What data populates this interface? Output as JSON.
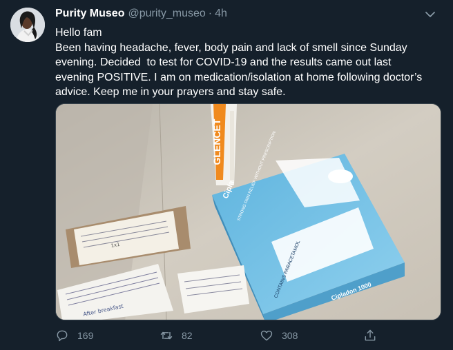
{
  "tweet": {
    "display_name": "Purity Museo",
    "handle": "@purity_museo",
    "separator": "·",
    "time": "4h",
    "text": "Hello fam\nBeen having headache, fever, body pain and lack of smell since Sunday evening. Decided  to test for COVID-19 and the results came out last evening POSITIVE. I am on medication/isolation at home following doctor’s advice. Keep me in your prayers and stay safe."
  },
  "media": {
    "glencet_label": "GLENCET",
    "box_brand": "Cipla",
    "box_title": "STRONG PAIN RELIEF WITHOUT PRESCRIPTION",
    "box_contains": "CONTAINS PARACETAMOL",
    "box_name_side": "Cipladon 1000",
    "box_name_front": "Cipladon 1000",
    "note_after": "After breakfast",
    "note_ix": "1x1"
  },
  "actions": {
    "reply_count": "169",
    "retweet_count": "82",
    "like_count": "308"
  },
  "icons": {
    "avatar": "avatar",
    "caret": "chevron-down-icon",
    "reply": "reply-icon",
    "retweet": "retweet-icon",
    "like": "heart-icon",
    "share": "share-icon"
  },
  "colors": {
    "background": "#15202b",
    "secondary_text": "#8899a6",
    "primary_text": "#ffffff"
  }
}
